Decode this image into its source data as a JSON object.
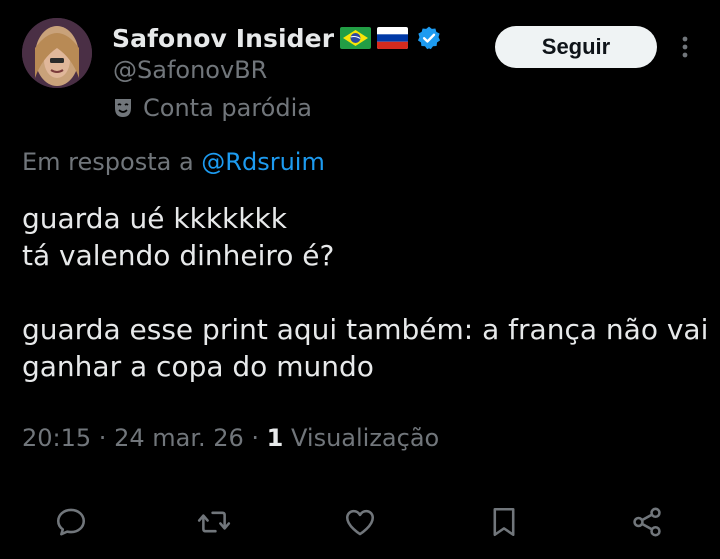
{
  "account": {
    "display_name": "Safonov Insider",
    "handle": "@SafonovBR",
    "parody_label": "Conta paródia",
    "follow_label": "Seguir",
    "flags": [
      "brazil-flag-icon",
      "russia-flag-icon"
    ],
    "verified_icon": "verified-badge-icon"
  },
  "reply": {
    "prefix": "Em resposta a",
    "mention": "@Rdsruim"
  },
  "tweet": {
    "line1": "guarda ué kkkkkkk",
    "line2": "tá valendo dinheiro é?",
    "line3": "guarda esse print aqui também: a frança não vai ganhar a copa do mundo"
  },
  "meta": {
    "time": "20:15",
    "separator": " · ",
    "date": "24 mar. 26",
    "view_count": "1",
    "view_label": "Visualização"
  },
  "actions": [
    "reply-icon",
    "retweet-icon",
    "like-icon",
    "bookmark-icon",
    "share-icon"
  ],
  "colors": {
    "background": "#000000",
    "text_primary": "#e7e9ea",
    "text_secondary": "#71767b",
    "accent": "#1d9bf0",
    "button_bg": "#eff3f4"
  }
}
